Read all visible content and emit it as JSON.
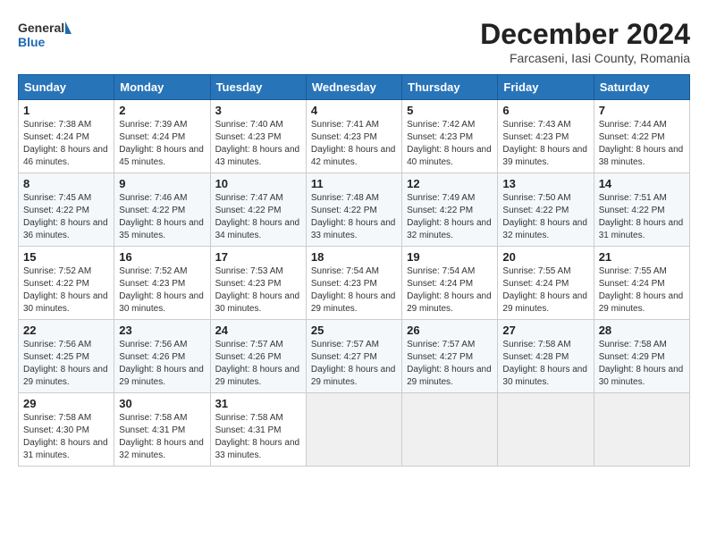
{
  "header": {
    "logo_line1": "General",
    "logo_line2": "Blue",
    "month_title": "December 2024",
    "location": "Farcaseni, Iasi County, Romania"
  },
  "days_of_week": [
    "Sunday",
    "Monday",
    "Tuesday",
    "Wednesday",
    "Thursday",
    "Friday",
    "Saturday"
  ],
  "weeks": [
    [
      {
        "day": "1",
        "sunrise": "7:38 AM",
        "sunset": "4:24 PM",
        "daylight": "8 hours and 46 minutes."
      },
      {
        "day": "2",
        "sunrise": "7:39 AM",
        "sunset": "4:24 PM",
        "daylight": "8 hours and 45 minutes."
      },
      {
        "day": "3",
        "sunrise": "7:40 AM",
        "sunset": "4:23 PM",
        "daylight": "8 hours and 43 minutes."
      },
      {
        "day": "4",
        "sunrise": "7:41 AM",
        "sunset": "4:23 PM",
        "daylight": "8 hours and 42 minutes."
      },
      {
        "day": "5",
        "sunrise": "7:42 AM",
        "sunset": "4:23 PM",
        "daylight": "8 hours and 40 minutes."
      },
      {
        "day": "6",
        "sunrise": "7:43 AM",
        "sunset": "4:23 PM",
        "daylight": "8 hours and 39 minutes."
      },
      {
        "day": "7",
        "sunrise": "7:44 AM",
        "sunset": "4:22 PM",
        "daylight": "8 hours and 38 minutes."
      }
    ],
    [
      {
        "day": "8",
        "sunrise": "7:45 AM",
        "sunset": "4:22 PM",
        "daylight": "8 hours and 36 minutes."
      },
      {
        "day": "9",
        "sunrise": "7:46 AM",
        "sunset": "4:22 PM",
        "daylight": "8 hours and 35 minutes."
      },
      {
        "day": "10",
        "sunrise": "7:47 AM",
        "sunset": "4:22 PM",
        "daylight": "8 hours and 34 minutes."
      },
      {
        "day": "11",
        "sunrise": "7:48 AM",
        "sunset": "4:22 PM",
        "daylight": "8 hours and 33 minutes."
      },
      {
        "day": "12",
        "sunrise": "7:49 AM",
        "sunset": "4:22 PM",
        "daylight": "8 hours and 32 minutes."
      },
      {
        "day": "13",
        "sunrise": "7:50 AM",
        "sunset": "4:22 PM",
        "daylight": "8 hours and 32 minutes."
      },
      {
        "day": "14",
        "sunrise": "7:51 AM",
        "sunset": "4:22 PM",
        "daylight": "8 hours and 31 minutes."
      }
    ],
    [
      {
        "day": "15",
        "sunrise": "7:52 AM",
        "sunset": "4:22 PM",
        "daylight": "8 hours and 30 minutes."
      },
      {
        "day": "16",
        "sunrise": "7:52 AM",
        "sunset": "4:23 PM",
        "daylight": "8 hours and 30 minutes."
      },
      {
        "day": "17",
        "sunrise": "7:53 AM",
        "sunset": "4:23 PM",
        "daylight": "8 hours and 30 minutes."
      },
      {
        "day": "18",
        "sunrise": "7:54 AM",
        "sunset": "4:23 PM",
        "daylight": "8 hours and 29 minutes."
      },
      {
        "day": "19",
        "sunrise": "7:54 AM",
        "sunset": "4:24 PM",
        "daylight": "8 hours and 29 minutes."
      },
      {
        "day": "20",
        "sunrise": "7:55 AM",
        "sunset": "4:24 PM",
        "daylight": "8 hours and 29 minutes."
      },
      {
        "day": "21",
        "sunrise": "7:55 AM",
        "sunset": "4:24 PM",
        "daylight": "8 hours and 29 minutes."
      }
    ],
    [
      {
        "day": "22",
        "sunrise": "7:56 AM",
        "sunset": "4:25 PM",
        "daylight": "8 hours and 29 minutes."
      },
      {
        "day": "23",
        "sunrise": "7:56 AM",
        "sunset": "4:26 PM",
        "daylight": "8 hours and 29 minutes."
      },
      {
        "day": "24",
        "sunrise": "7:57 AM",
        "sunset": "4:26 PM",
        "daylight": "8 hours and 29 minutes."
      },
      {
        "day": "25",
        "sunrise": "7:57 AM",
        "sunset": "4:27 PM",
        "daylight": "8 hours and 29 minutes."
      },
      {
        "day": "26",
        "sunrise": "7:57 AM",
        "sunset": "4:27 PM",
        "daylight": "8 hours and 29 minutes."
      },
      {
        "day": "27",
        "sunrise": "7:58 AM",
        "sunset": "4:28 PM",
        "daylight": "8 hours and 30 minutes."
      },
      {
        "day": "28",
        "sunrise": "7:58 AM",
        "sunset": "4:29 PM",
        "daylight": "8 hours and 30 minutes."
      }
    ],
    [
      {
        "day": "29",
        "sunrise": "7:58 AM",
        "sunset": "4:30 PM",
        "daylight": "8 hours and 31 minutes."
      },
      {
        "day": "30",
        "sunrise": "7:58 AM",
        "sunset": "4:31 PM",
        "daylight": "8 hours and 32 minutes."
      },
      {
        "day": "31",
        "sunrise": "7:58 AM",
        "sunset": "4:31 PM",
        "daylight": "8 hours and 33 minutes."
      },
      null,
      null,
      null,
      null
    ]
  ],
  "labels": {
    "sunrise": "Sunrise:",
    "sunset": "Sunset:",
    "daylight": "Daylight:"
  }
}
